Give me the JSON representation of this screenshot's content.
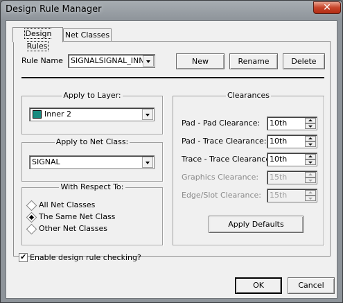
{
  "window": {
    "title": "Design Rule Manager",
    "close_glyph": "✕"
  },
  "tabs": [
    {
      "label": "Design Rules"
    },
    {
      "label": "Net Classes"
    }
  ],
  "rule_name": {
    "label": "Rule Name",
    "value": "SIGNALSIGNAL_INNI"
  },
  "buttons": {
    "new": "New",
    "rename": "Rename",
    "delete": "Delete",
    "apply_defaults": "Apply Defaults",
    "ok": "OK",
    "cancel": "Cancel"
  },
  "layer_group": {
    "title": "Apply to Layer:",
    "value": "Inner 2",
    "swatch_color": "#178a7e"
  },
  "netclass_group": {
    "title": "Apply to Net Class:",
    "value": "SIGNAL"
  },
  "respect_group": {
    "title": "With Respect To:",
    "options": [
      {
        "label": "All Net Classes",
        "selected": false
      },
      {
        "label": "The Same Net Class",
        "selected": true
      },
      {
        "label": "Other Net Classes",
        "selected": false
      }
    ]
  },
  "clearances": {
    "title": "Clearances",
    "rows": [
      {
        "label": "Pad - Pad Clearance:",
        "value": "10th",
        "enabled": true
      },
      {
        "label": "Pad - Trace Clearance:",
        "value": "10th",
        "enabled": true
      },
      {
        "label": "Trace - Trace Clearance:",
        "value": "10th",
        "enabled": true
      },
      {
        "label": "Graphics Clearance:",
        "value": "15th",
        "enabled": false
      },
      {
        "label": "Edge/Slot Clearance:",
        "value": "15th",
        "enabled": false
      }
    ]
  },
  "enable_check": {
    "label": "Enable design rule checking?",
    "checked": true
  }
}
